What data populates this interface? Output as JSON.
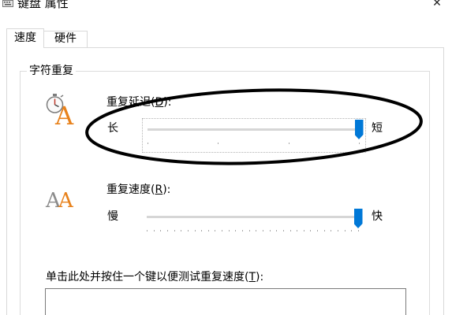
{
  "window": {
    "title": "键盘 属性",
    "icon": "keyboard-icon",
    "close_icon": "close-icon",
    "close_glyph": "✕"
  },
  "tabs": [
    {
      "label": "速度",
      "selected": true
    },
    {
      "label": "硬件",
      "selected": false
    }
  ],
  "character_repeat": {
    "title": "字符重复",
    "repeat_delay": {
      "icon": "stopwatch-icon",
      "label_prefix": "重复延迟(",
      "access_key": "D",
      "label_suffix": "):",
      "min_label": "长",
      "max_label": "短",
      "level": 1
    },
    "repeat_rate": {
      "icon": "repeat-rate-icon",
      "label_prefix": "重复速度(",
      "access_key": "R",
      "label_suffix": "):",
      "min_label": "慢",
      "max_label": "快",
      "level": 1
    },
    "test_area": {
      "label_prefix": "单击此处并按住一个键以便测试重复速度(",
      "access_key": "T",
      "label_suffix": "):",
      "value": ""
    }
  },
  "icon_letter": "A",
  "colors": {
    "accent": "#0078d7",
    "icon_orange": "#e8821c",
    "icon_gray": "#8c8c8c",
    "annotation": "#000000"
  }
}
